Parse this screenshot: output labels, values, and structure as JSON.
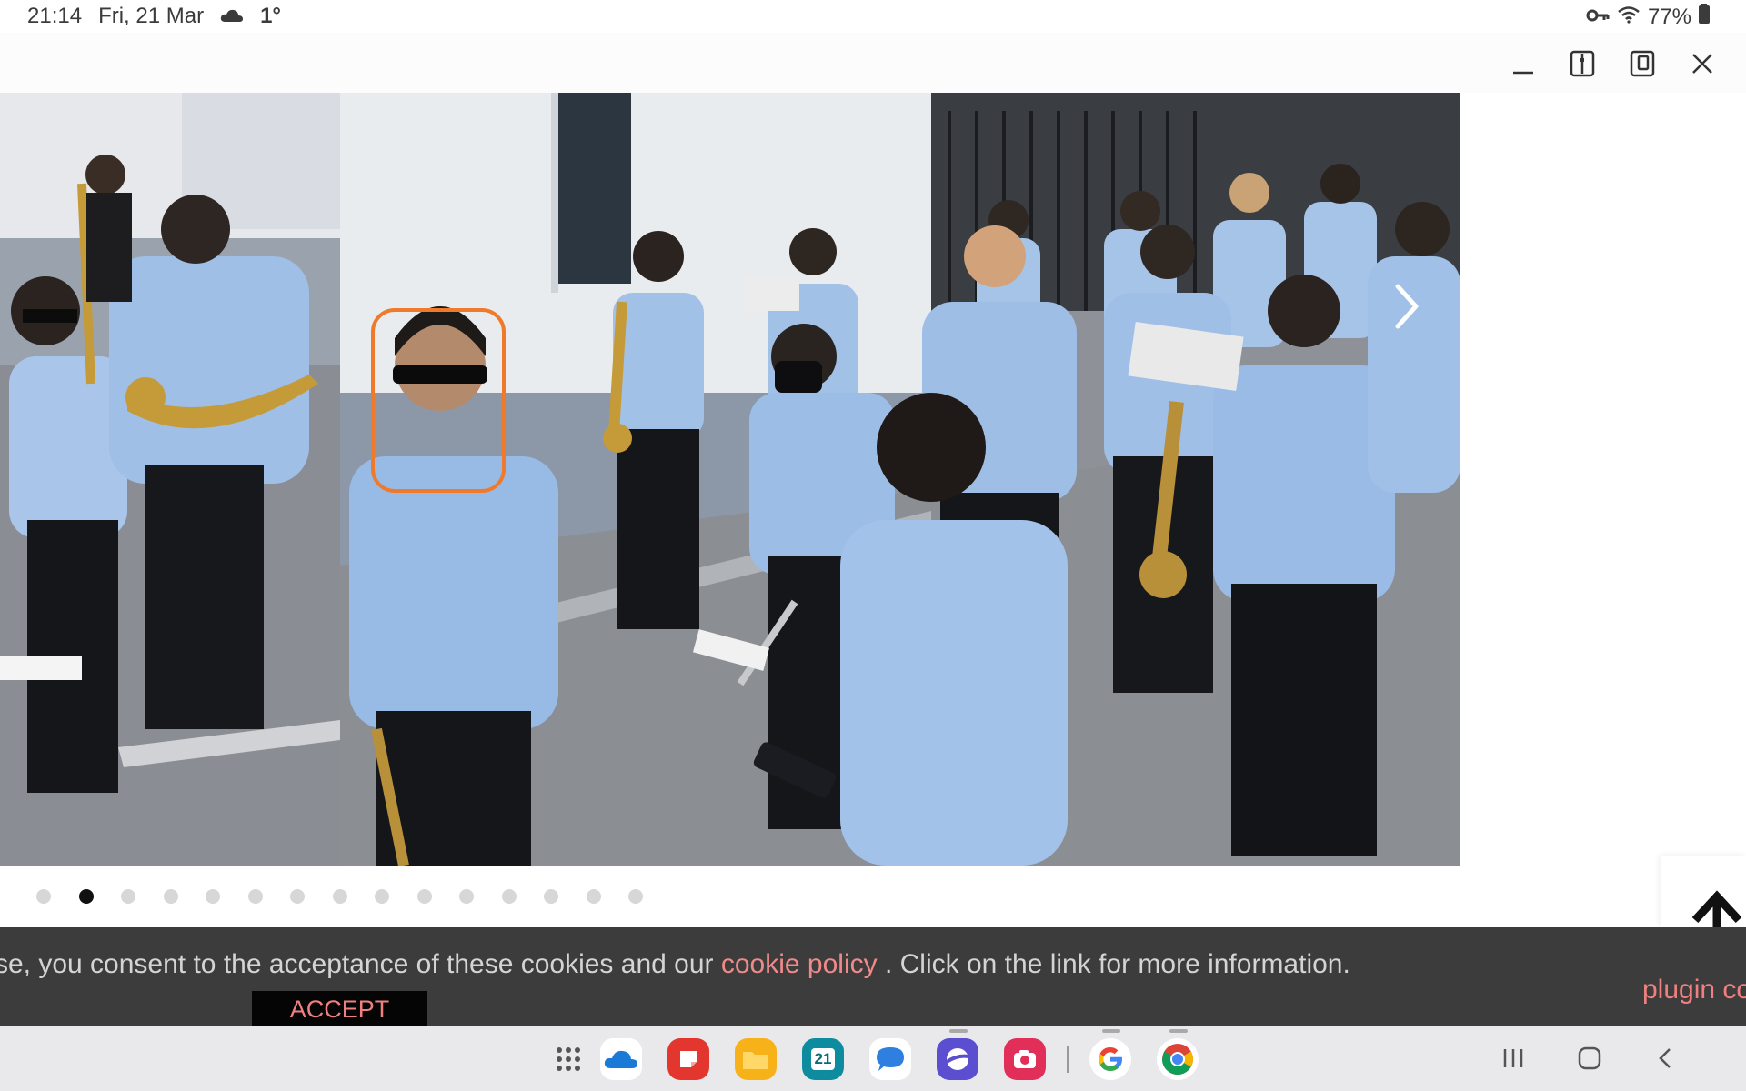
{
  "status_bar": {
    "time": "21:14",
    "date": "Fri, 21 Mar",
    "temperature": "1°",
    "battery": "77%",
    "icons": [
      "cloud-icon",
      "key-icon",
      "wifi-icon",
      "battery-icon"
    ]
  },
  "window_controls": {
    "icons": [
      "minimize-icon",
      "split-view-icon",
      "popup-view-icon",
      "close-icon"
    ]
  },
  "carousel": {
    "total_slides": 15,
    "active_index": 1,
    "next_icon": "chevron-right-icon",
    "highlight_color": "#f07a2c"
  },
  "scroll_top": {
    "icon": "arrow-up-icon"
  },
  "cookie_banner": {
    "text_before": "se, you consent to the acceptance of these cookies and our ",
    "link_text": "cookie policy",
    "text_after": " . Click on the link for more information.",
    "accept_label": "ACCEPT",
    "plugin_text": "plugin co",
    "background": "#3c3c3c",
    "link_color": "#f08a8a"
  },
  "taskbar": {
    "apps": [
      {
        "name": "apps-grid-icon"
      },
      {
        "name": "onedrive-icon"
      },
      {
        "name": "notes-icon"
      },
      {
        "name": "files-icon"
      },
      {
        "name": "calendar-icon",
        "label": "21"
      },
      {
        "name": "messages-icon"
      },
      {
        "name": "browser-icon"
      },
      {
        "name": "camera-icon"
      },
      {
        "name": "google-icon"
      },
      {
        "name": "chrome-icon"
      }
    ],
    "nav": [
      "recents-icon",
      "home-icon",
      "back-icon"
    ]
  }
}
